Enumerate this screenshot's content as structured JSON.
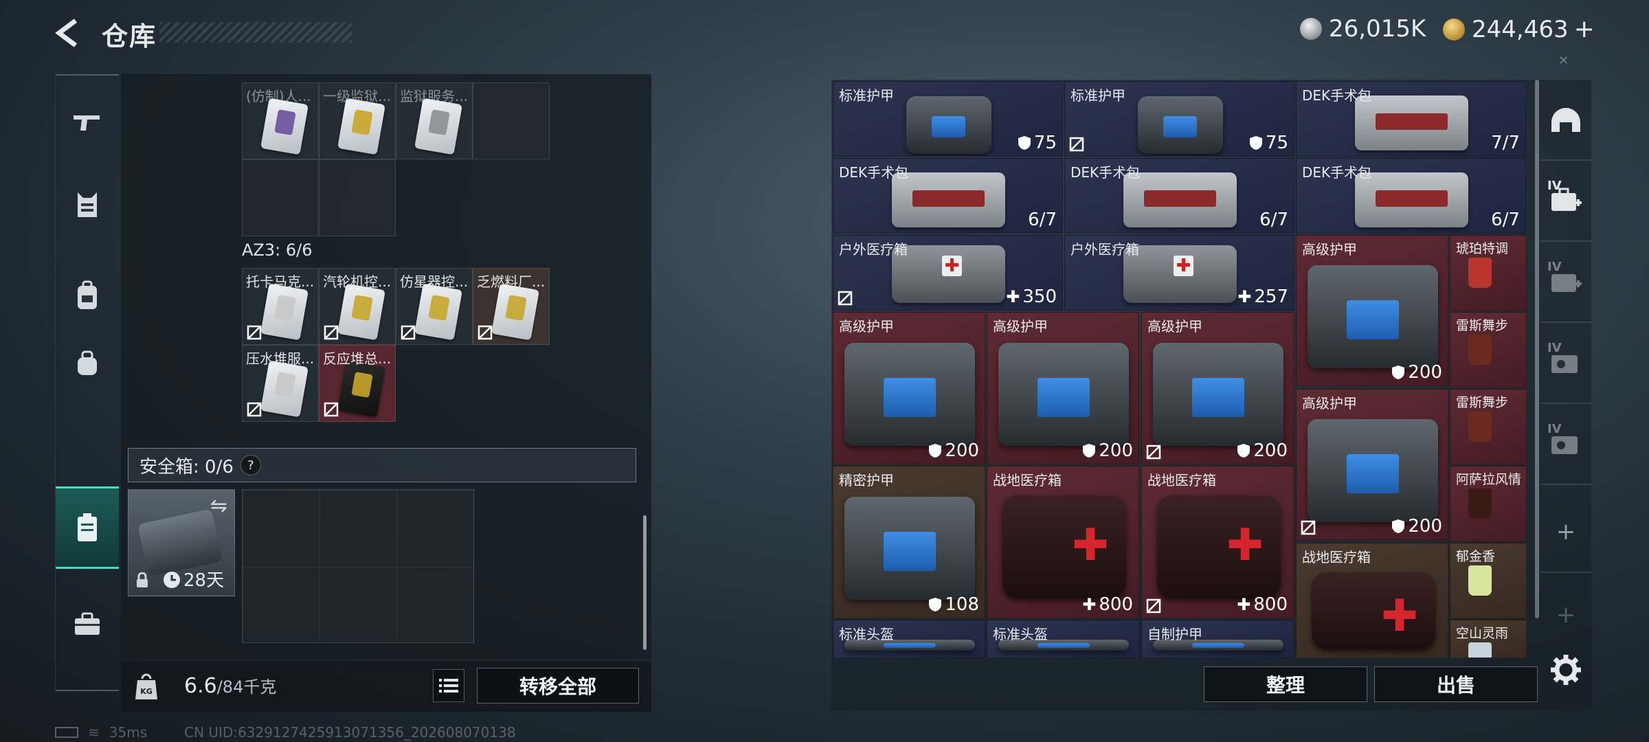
{
  "header": {
    "title": "仓库",
    "currency_silver": "26,015K",
    "currency_gold": "244,463",
    "currency_plus": "+",
    "close_glyph": "✕"
  },
  "left_nav": {
    "items": [
      "gun-icon",
      "vest-icon",
      "backpack-icon",
      "bag-icon",
      "safe-box-icon",
      "toolbox-icon"
    ],
    "active_index": 4
  },
  "storage": {
    "top_row": [
      {
        "label": "(仿制)人...",
        "color": "#6a4fa0"
      },
      {
        "label": "一级监狱...",
        "color": "#c8a52a"
      },
      {
        "label": "监狱服务...",
        "color": "#8a8f95"
      }
    ],
    "az3_label": "AZ3: 6/6",
    "az3_items": [
      {
        "label": "托卡马克...",
        "color": "#c8c8c8"
      },
      {
        "label": "汽轮机控...",
        "color": "#c8a52a"
      },
      {
        "label": "仿星器控...",
        "color": "#c8a52a"
      },
      {
        "label": "乏燃料厂...",
        "color": "#c8a52a"
      },
      {
        "label": "压水堆服...",
        "color": "#c8c8c8"
      },
      {
        "label": "反应堆总...",
        "color": "#c8a52a"
      }
    ]
  },
  "safe": {
    "label": "安全箱: 0/6",
    "help": "?",
    "timer": "28天",
    "swap_glyph": "⇋"
  },
  "bottom_left": {
    "weight_value": "6.6",
    "weight_max": "/84千克",
    "kg_badge": "KG",
    "transfer_all": "转移全部"
  },
  "right_grid": {
    "items": [
      {
        "label": "标准护甲",
        "value": "75",
        "icon": "shield",
        "noloot": false,
        "bg": "blue",
        "art": "vest"
      },
      {
        "label": "标准护甲",
        "value": "75",
        "icon": "shield",
        "noloot": true,
        "bg": "blue",
        "art": "vest"
      },
      {
        "label": "DEK手术包",
        "value": "7/7",
        "icon": "",
        "noloot": false,
        "bg": "blue",
        "art": "medkit"
      },
      {
        "label": "DEK手术包",
        "value": "6/7",
        "icon": "",
        "noloot": false,
        "bg": "blue",
        "art": "medkit"
      },
      {
        "label": "DEK手术包",
        "value": "6/7",
        "icon": "",
        "noloot": false,
        "bg": "blue",
        "art": "medkit"
      },
      {
        "label": "DEK手术包",
        "value": "6/7",
        "icon": "",
        "noloot": false,
        "bg": "blue",
        "art": "medkit"
      },
      {
        "label": "户外医疗箱",
        "value": "350",
        "icon": "plus",
        "noloot": true,
        "bg": "blue",
        "art": "outkit"
      },
      {
        "label": "户外医疗箱",
        "value": "257",
        "icon": "plus",
        "noloot": false,
        "bg": "blue",
        "art": "outkit"
      },
      {
        "label": "高级护甲",
        "value": "200",
        "icon": "shield",
        "noloot": false,
        "bg": "red",
        "art": "vest"
      },
      {
        "label": "琥珀特调",
        "value": "",
        "icon": "",
        "noloot": false,
        "bg": "red",
        "art": "drink"
      },
      {
        "label": "高级护甲",
        "value": "200",
        "icon": "shield",
        "noloot": false,
        "bg": "red",
        "art": "vest"
      },
      {
        "label": "高级护甲",
        "value": "200",
        "icon": "shield",
        "noloot": false,
        "bg": "red",
        "art": "vest"
      },
      {
        "label": "高级护甲",
        "value": "200",
        "icon": "shield",
        "noloot": true,
        "bg": "red",
        "art": "vest"
      },
      {
        "label": "雷斯舞步",
        "value": "",
        "icon": "",
        "noloot": false,
        "bg": "red",
        "art": "drink"
      },
      {
        "label": "高级护甲",
        "value": "200",
        "icon": "shield",
        "noloot": true,
        "bg": "red",
        "art": "vest"
      },
      {
        "label": "雷斯舞步",
        "value": "",
        "icon": "",
        "noloot": false,
        "bg": "red",
        "art": "drink"
      },
      {
        "label": "精密护甲",
        "value": "108",
        "icon": "shield",
        "noloot": false,
        "bg": "brown",
        "art": "vest"
      },
      {
        "label": "战地医疗箱",
        "value": "800",
        "icon": "plus",
        "noloot": false,
        "bg": "red",
        "art": "redkit"
      },
      {
        "label": "战地医疗箱",
        "value": "800",
        "icon": "plus",
        "noloot": true,
        "bg": "red",
        "art": "redkit"
      },
      {
        "label": "阿萨拉风情",
        "value": "",
        "icon": "",
        "noloot": false,
        "bg": "red",
        "art": "drink"
      },
      {
        "label": "战地医疗箱",
        "value": "",
        "icon": "",
        "noloot": false,
        "bg": "brown",
        "art": "redkit"
      },
      {
        "label": "郁金香",
        "value": "",
        "icon": "",
        "noloot": false,
        "bg": "brown",
        "art": "drink"
      },
      {
        "label": "标准头盔",
        "value": "",
        "icon": "",
        "noloot": false,
        "bg": "blue",
        "art": "vest"
      },
      {
        "label": "标准头盔",
        "value": "",
        "icon": "",
        "noloot": false,
        "bg": "blue",
        "art": "vest"
      },
      {
        "label": "自制护甲",
        "value": "",
        "icon": "",
        "noloot": false,
        "bg": "blue",
        "art": "vest"
      },
      {
        "label": "空山灵雨",
        "value": "",
        "icon": "",
        "noloot": false,
        "bg": "brown",
        "art": "drink"
      }
    ]
  },
  "right_nav": {
    "items": [
      "helmet-icon",
      "medical-case-icon",
      "medical-case-icon",
      "keycard-icon",
      "keycard-icon",
      "add-icon",
      "add-icon"
    ],
    "tier_label": "IV",
    "plus_glyph": "+"
  },
  "bottom_right": {
    "sort": "整理",
    "sell": "出售"
  },
  "status": {
    "ping": "35ms",
    "uid": "CN UID:6329127425913071356_202608070138"
  },
  "colors": {
    "accent": "#3fe0c4",
    "blue_item": "#2d3450",
    "red_item": "#5e2a33",
    "brown_item": "#4a3a30"
  }
}
